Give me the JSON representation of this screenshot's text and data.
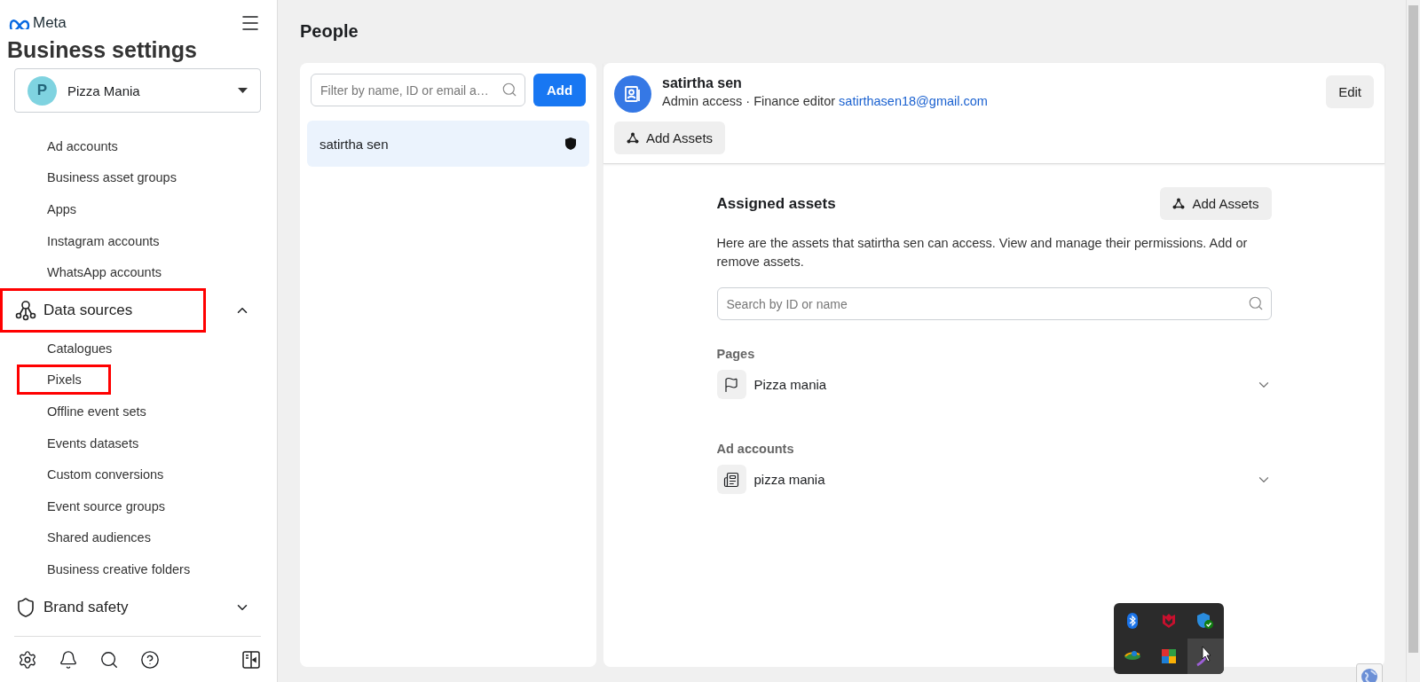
{
  "sidebar": {
    "logo": "Meta",
    "title": "Business settings",
    "account": {
      "initial": "P",
      "name": "Pizza Mania"
    },
    "items": [
      {
        "label": "Ad accounts",
        "highlighted": false
      },
      {
        "label": "Business asset groups",
        "highlighted": false
      },
      {
        "label": "Apps",
        "highlighted": false
      },
      {
        "label": "Instagram accounts",
        "highlighted": false
      },
      {
        "label": "WhatsApp accounts",
        "highlighted": false
      }
    ],
    "sections": [
      {
        "label": "Data sources",
        "expanded": true,
        "highlighted": true,
        "children": [
          {
            "label": "Catalogues",
            "highlighted": false
          },
          {
            "label": "Pixels",
            "highlighted": true
          },
          {
            "label": "Offline event sets",
            "highlighted": false
          },
          {
            "label": "Events datasets",
            "highlighted": false
          },
          {
            "label": "Custom conversions",
            "highlighted": false
          },
          {
            "label": "Event source groups",
            "highlighted": false
          },
          {
            "label": "Shared audiences",
            "highlighted": false
          },
          {
            "label": "Business creative folders",
            "highlighted": false
          }
        ]
      },
      {
        "label": "Brand safety",
        "expanded": false,
        "highlighted": false
      }
    ]
  },
  "page": {
    "title": "People"
  },
  "people": {
    "search": {
      "placeholder": "Filter by name, ID or email a…"
    },
    "add_button": "Add",
    "list": [
      {
        "name": "satirtha sen",
        "selected": true
      }
    ]
  },
  "person": {
    "name": "satirtha sen",
    "role": "Admin access · Finance editor",
    "email": "satirthasen18@gmail.com",
    "edit_button": "Edit",
    "add_assets_button": "Add Assets"
  },
  "assets": {
    "title": "Assigned assets",
    "add_button": "Add Assets",
    "description": "Here are the assets that satirtha sen can access. View and manage their permissions. Add or remove assets.",
    "search": {
      "placeholder": "Search by ID or name"
    },
    "groups": [
      {
        "label": "Pages",
        "items": [
          {
            "name": "Pizza mania"
          }
        ]
      },
      {
        "label": "Ad accounts",
        "items": [
          {
            "name": "pizza mania"
          }
        ]
      }
    ]
  }
}
